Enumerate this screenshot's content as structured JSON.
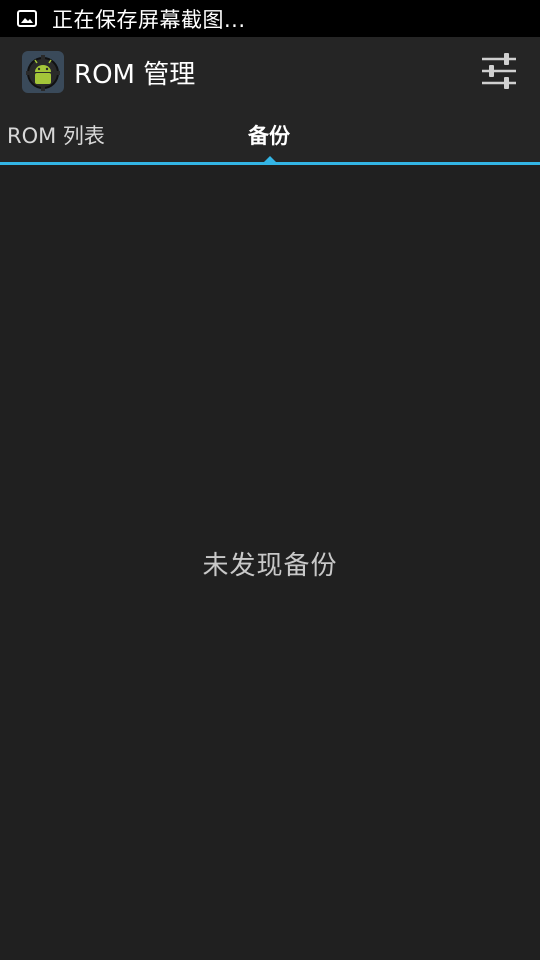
{
  "status_bar": {
    "notification_icon": "image-icon",
    "text": "正在保存屏幕截图..."
  },
  "action_bar": {
    "app_icon": "android-gear-icon",
    "title": "ROM 管理",
    "settings_icon": "sliders-icon"
  },
  "tabs": [
    {
      "label": "ROM 列表",
      "selected": false
    },
    {
      "label": "备份",
      "selected": true
    }
  ],
  "content": {
    "empty_message": "未发现备份"
  },
  "colors": {
    "accent": "#33b5e5",
    "background": "#202020",
    "status_bar": "#000000"
  }
}
